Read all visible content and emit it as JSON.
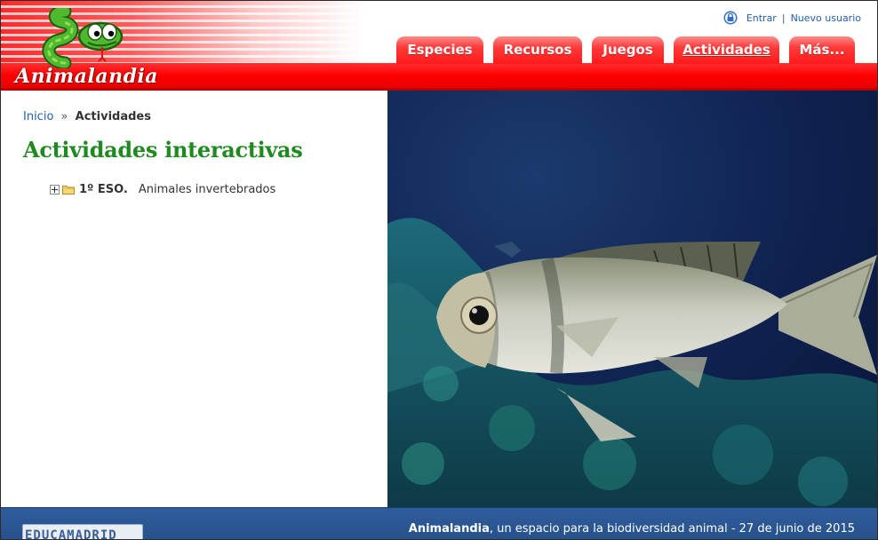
{
  "header": {
    "logo_text": "Animalandia",
    "user_links": {
      "login": "Entrar",
      "separator": "|",
      "register": "Nuevo usuario"
    },
    "tabs": [
      {
        "label": "Especies",
        "active": false
      },
      {
        "label": "Recursos",
        "active": false
      },
      {
        "label": "Juegos",
        "active": false
      },
      {
        "label": "Actividades",
        "active": true
      },
      {
        "label": "Más...",
        "active": false
      }
    ]
  },
  "breadcrumb": {
    "home": "Inicio",
    "separator": "»",
    "current": "Actividades"
  },
  "main": {
    "title": "Actividades interactivas",
    "tree": [
      {
        "level": "1º ESO.",
        "label": "Animales invertebrados"
      }
    ]
  },
  "footer": {
    "logo_text": "EDUCAMADRID",
    "site_name": "Animalandia",
    "tagline": ", un espacio para la biodiversidad animal - 27 de junio de 2015"
  },
  "colors": {
    "brand_red": "#ff0000",
    "title_green": "#1f8a1f",
    "link_blue": "#2060b0",
    "footer_blue": "#2f5d9c"
  },
  "icons": [
    "snake-logo-icon",
    "lock-icon",
    "expand-icon",
    "folder-icon"
  ]
}
